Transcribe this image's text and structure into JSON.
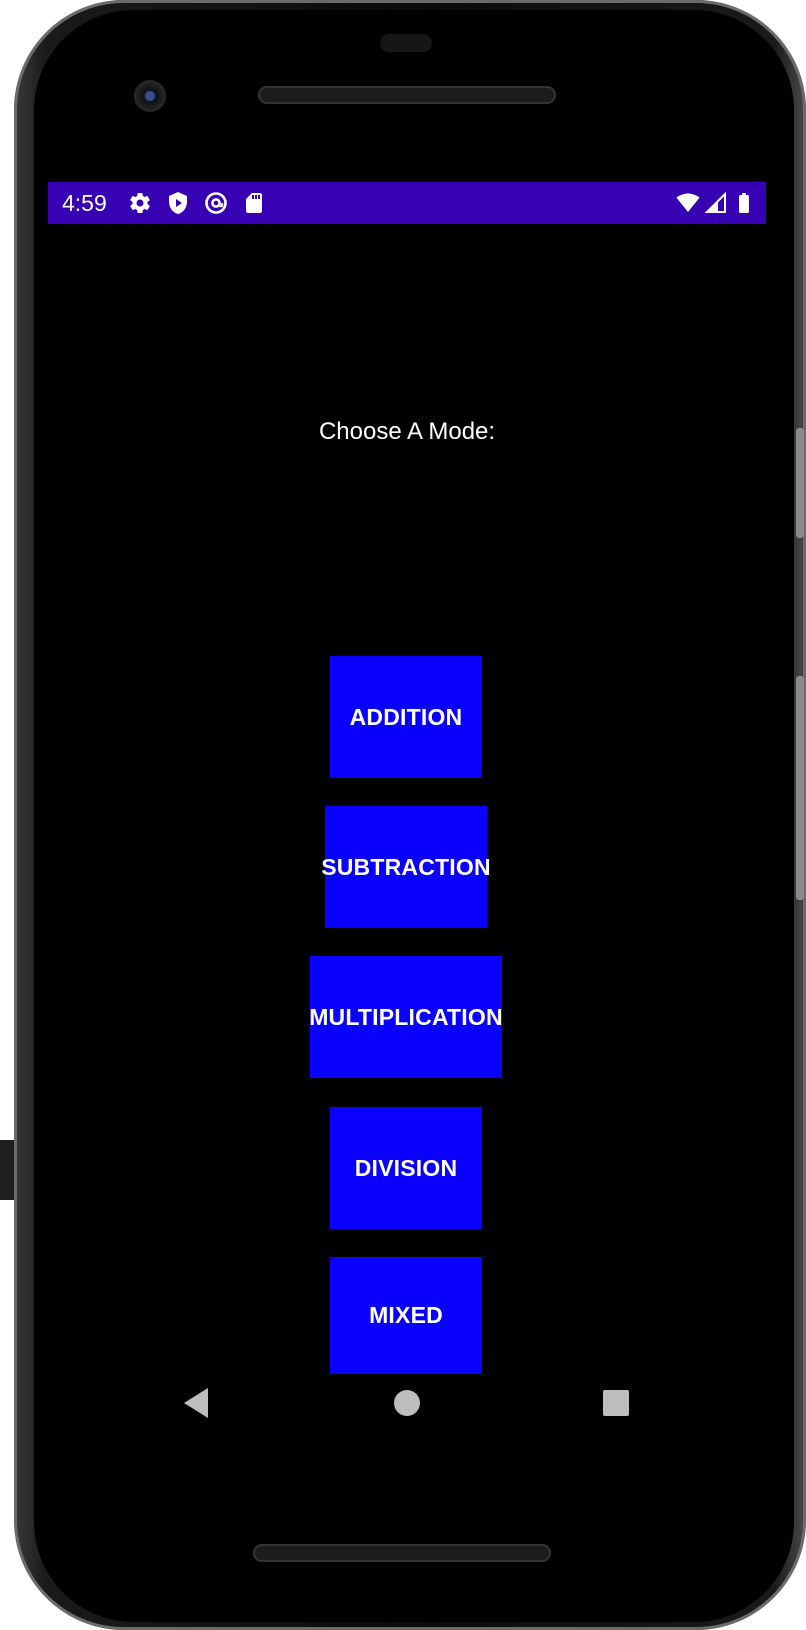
{
  "status_bar": {
    "time": "4:59",
    "left_icons": [
      "gear-icon",
      "shield-play-icon",
      "at-sign-icon",
      "sd-card-icon"
    ],
    "right_icons": [
      "wifi-icon",
      "cell-signal-icon",
      "battery-icon"
    ],
    "background_color": "#3700b3"
  },
  "screen": {
    "title": "Choose A Mode:",
    "background_color": "#000000"
  },
  "modes": [
    {
      "label": "ADDITION"
    },
    {
      "label": "SUBTRACTION"
    },
    {
      "label": "MULTIPLICATION"
    },
    {
      "label": "DIVISION"
    },
    {
      "label": "MIXED"
    }
  ],
  "button_color": "#0a00ff",
  "nav_bar": {
    "back": "back-triangle-icon",
    "home": "home-circle-icon",
    "recents": "recents-square-icon"
  }
}
